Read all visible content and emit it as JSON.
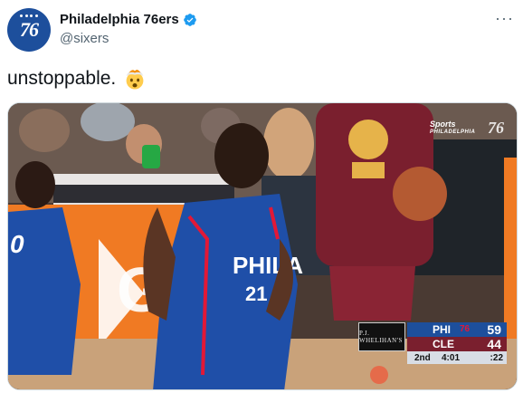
{
  "author": {
    "display_name": "Philadelphia 76ers",
    "handle": "@sixers",
    "avatar_text": "76",
    "verified": true
  },
  "tweet": {
    "text": "unstoppable.",
    "emoji": "exploding-head-emoji"
  },
  "more_menu": "···",
  "media": {
    "jersey_text": "PHILA",
    "jersey_number": "21",
    "left_jersey_number": "0",
    "scorebug": {
      "sponsor": "P.J. WHELIHAN'S",
      "home_seed": "76",
      "teams": [
        {
          "abbr": "PHI",
          "score": "59",
          "color": "#1d4f9c"
        },
        {
          "abbr": "CLE",
          "score": "44",
          "color": "#7a1f2e"
        }
      ],
      "quarter": "2nd",
      "clock": "4:01",
      "shot_clock": ":22"
    },
    "broadcast_logo": {
      "name": "Sports",
      "sub": "PHILADELPHIA"
    },
    "channel_bug": "76"
  },
  "colors": {
    "accent": "#1d9bf0",
    "sixers_blue": "#1d4f9c",
    "sixers_red": "#e21837"
  }
}
